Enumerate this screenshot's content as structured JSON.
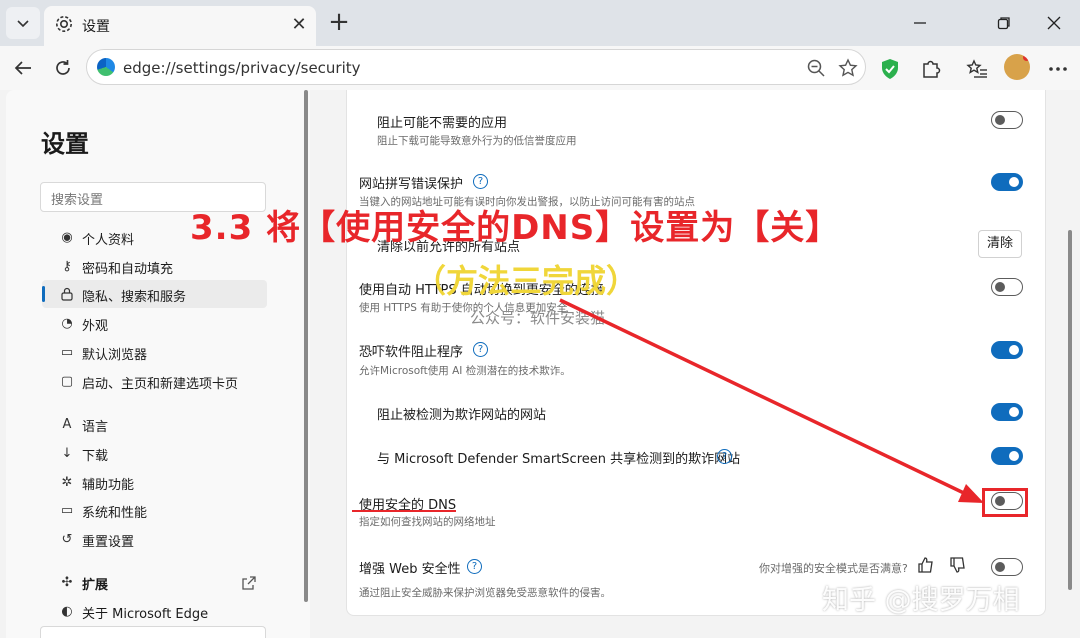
{
  "browser": {
    "tab_title": "设置",
    "url": "edge://settings/privacy/security",
    "new_tab_symbol": "+"
  },
  "sidebar": {
    "title": "设置",
    "search_placeholder": "搜索设置",
    "items": [
      {
        "label": "个人资料",
        "icon": "profile-icon"
      },
      {
        "label": "密码和自动填充",
        "icon": "key-icon"
      },
      {
        "label": "隐私、搜索和服务",
        "icon": "lock-icon",
        "active": true
      },
      {
        "label": "外观",
        "icon": "palette-icon"
      },
      {
        "label": "默认浏览器",
        "icon": "browser-icon"
      },
      {
        "label": "启动、主页和新建选项卡页",
        "icon": "home-icon"
      },
      {
        "label": "语言",
        "icon": "language-icon"
      },
      {
        "label": "下载",
        "icon": "download-icon"
      },
      {
        "label": "辅助功能",
        "icon": "accessibility-icon"
      },
      {
        "label": "系统和性能",
        "icon": "laptop-icon"
      },
      {
        "label": "重置设置",
        "icon": "reset-icon"
      },
      {
        "label": "扩展",
        "icon": "extension-icon"
      },
      {
        "label": "关于 Microsoft Edge",
        "icon": "edge-icon"
      }
    ]
  },
  "settings": {
    "pua_title": "阻止可能不需要的应用",
    "pua_desc": "阻止下载可能导致意外行为的低信誉度应用",
    "pua_on": false,
    "typo_title": "网站拼写错误保护",
    "typo_desc": "当键入的网站地址可能有误时向你发出警报，以防止访问可能有害的站点",
    "typo_on": true,
    "clear_title": "清除以前允许的所有站点",
    "clear_button": "清除",
    "https_title": "使用自动 HTTPS 自动切换到更安全的连接",
    "https_desc": "使用 HTTPS 有助于使你的个人信息更加安全",
    "https_on": false,
    "scareware_title": "恐吓软件阻止程序",
    "scareware_desc": "允许Microsoft使用 AI 检测潜在的技术欺诈。",
    "scareware_on": true,
    "block_scam_title": "阻止被检测为欺诈网站的网站",
    "block_scam_on": true,
    "share_title": "与 Microsoft Defender SmartScreen 共享检测到的欺诈网站",
    "share_on": true,
    "dns_title": "使用安全的 DNS",
    "dns_desc": "指定如何查找网站的网络地址",
    "dns_on": false,
    "web_sec_title": "增强 Web 安全性",
    "web_sec_desc": "通过阻止安全威胁来保护浏览器免受恶意软件的侵害。",
    "web_sec_on": false,
    "feedback_question": "你对增强的安全模式是否满意?"
  },
  "annotations": {
    "headline": "3.3 将【使用安全的DNS】设置为【关】",
    "subline": "（方法三完成）",
    "watermark_center": "公众号：软件安装猫",
    "watermark_corner": "知乎 @搜罗万相"
  },
  "colors": {
    "accent": "#0f6cbd",
    "annotation_red": "#e8262a",
    "annotation_yellow": "#f0d63a"
  }
}
